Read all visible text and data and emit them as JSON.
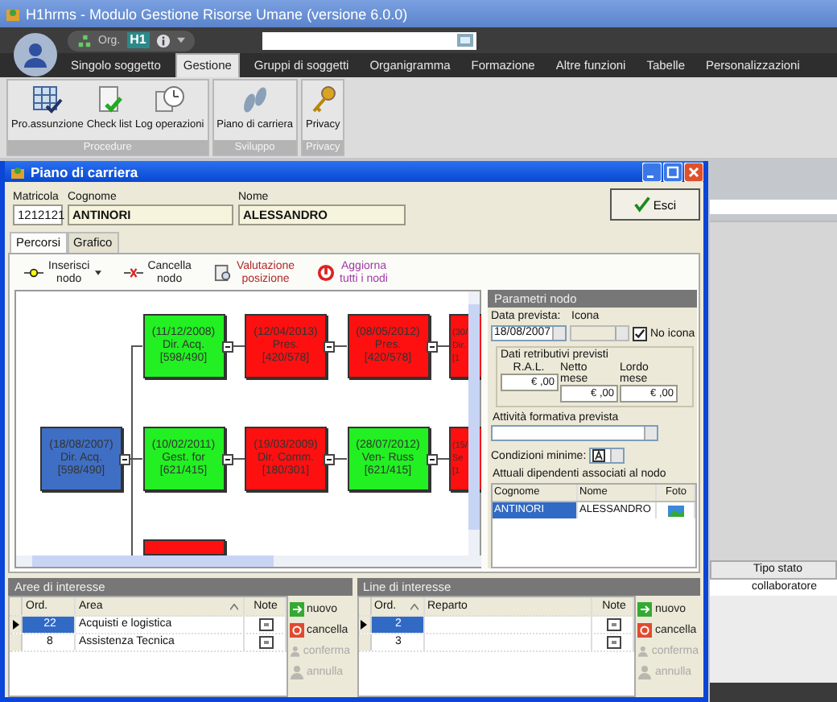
{
  "window": {
    "title": "H1hrms - Modulo Gestione Risorse Umane (versione 6.0.0)"
  },
  "quick_access": {
    "org_label": "Org.",
    "logo": "H1"
  },
  "ribbon_tabs": [
    {
      "label": "Singolo soggetto",
      "selected": false
    },
    {
      "label": "Gestione",
      "selected": true
    },
    {
      "label": "Gruppi di soggetti",
      "selected": false
    },
    {
      "label": "Organigramma",
      "selected": false
    },
    {
      "label": "Formazione",
      "selected": false
    },
    {
      "label": "Altre funzioni",
      "selected": false
    },
    {
      "label": "Tabelle",
      "selected": false
    },
    {
      "label": "Personalizzazioni",
      "selected": false
    }
  ],
  "ribbon_groups": [
    {
      "title": "Procedure",
      "buttons": [
        {
          "label": "Pro.assunzione",
          "kind": "grid"
        },
        {
          "label": "Check list",
          "kind": "checklist"
        },
        {
          "label": "Log operazioni",
          "kind": "clock"
        }
      ]
    },
    {
      "title": "Sviluppo",
      "buttons": [
        {
          "label": "Piano di carriera",
          "kind": "steps"
        }
      ]
    },
    {
      "title": "Privacy",
      "buttons": [
        {
          "label": "Privacy",
          "kind": "key"
        }
      ]
    }
  ],
  "background_table": {
    "column": "Tipo stato",
    "value": "collaboratore"
  },
  "dialog": {
    "title": "Piano di carriera",
    "fields": [
      {
        "label": "Matricola",
        "value": "1212121",
        "readonly": false
      },
      {
        "label": "Cognome",
        "value": "ANTINORI",
        "readonly": true
      },
      {
        "label": "Nome",
        "value": "ALESSANDRO",
        "readonly": true
      }
    ],
    "exit_button": "Esci",
    "tabs": [
      {
        "label": "Percorsi",
        "selected": true
      },
      {
        "label": "Grafico",
        "selected": false
      }
    ],
    "toolbar": [
      {
        "lines": [
          "Inserisci",
          "nodo"
        ],
        "kind": "insert",
        "menu": true,
        "color": "#202020"
      },
      {
        "lines": [
          "Cancella",
          "nodo"
        ],
        "kind": "delete",
        "menu": false,
        "color": "#202020"
      },
      {
        "lines": [
          "Valutazione",
          "posizione"
        ],
        "kind": "evaluate",
        "menu": false,
        "color": "#b02828"
      },
      {
        "lines": [
          "Aggiorna",
          "tutti i nodi"
        ],
        "kind": "refresh",
        "menu": false,
        "color": "#a03ca8"
      }
    ],
    "tree": {
      "lines": [
        "(18/08/2007)",
        "Dir. Acq.",
        "[598/490]"
      ],
      "color": "#3f6fc4",
      "children": [
        {
          "lines": [
            "(11/12/2008)",
            "Dir. Acq.",
            "[598/490]"
          ],
          "color": "#22f022",
          "children": [
            {
              "lines": [
                "(12/04/2013)",
                "Pres.",
                "[420/578]"
              ],
              "color": "#ff1010",
              "children": [
                {
                  "lines": [
                    "(08/05/2012)",
                    "Pres.",
                    "[420/578]"
                  ],
                  "color": "#ff1010",
                  "children": [
                    {
                      "lines": [
                        "(30/",
                        "Dir.",
                        "[1"
                      ],
                      "color": "#ff1010"
                    }
                  ]
                }
              ]
            }
          ]
        },
        {
          "lines": [
            "(10/02/2011)",
            "Gest. for",
            "[621/415]"
          ],
          "color": "#22f022",
          "children": [
            {
              "lines": [
                "(19/03/2009)",
                "Dir. Comm.",
                "[180/301]"
              ],
              "color": "#ff1010",
              "children": [
                {
                  "lines": [
                    "(28/07/2012)",
                    "Ven- Russ",
                    "[621/415]"
                  ],
                  "color": "#22f022",
                  "children": [
                    {
                      "lines": [
                        "(15/",
                        "Se",
                        "[1"
                      ],
                      "color": "#ff1010"
                    }
                  ]
                }
              ]
            }
          ]
        },
        {
          "color": "#ff1010"
        }
      ]
    },
    "node_params": {
      "title": "Parametri nodo",
      "date": {
        "label": "Data prevista:",
        "value": "18/08/2007"
      },
      "icon": {
        "label": "Icona",
        "disabled": true
      },
      "no_icon": {
        "label": "No icona",
        "checked": true
      },
      "salary": {
        "title": "Dati retributivi previsti",
        "fields": [
          {
            "label": "R.A.L.",
            "value": "€ ,00"
          },
          {
            "label": "Netto mese",
            "value": "€ ,00"
          },
          {
            "label": "Lordo mese",
            "value": "€ ,00"
          }
        ]
      },
      "training": {
        "label": "Attività formativa prevista"
      },
      "min_conditions": {
        "label": "Condizioni minime:"
      },
      "employees": {
        "title": "Attuali dipendenti associati al nodo",
        "columns": [
          "Cognome",
          "Nome",
          "Foto"
        ],
        "rows": [
          {
            "cells": [
              "ANTINORI",
              "ALESSANDRO"
            ],
            "selected": true
          }
        ]
      }
    },
    "panels": [
      {
        "title": "Aree di interesse",
        "columns": [
          {
            "label": "Ord.",
            "sorted": false
          },
          {
            "label": "Area",
            "sorted": true
          },
          {
            "label": "Note",
            "sorted": false
          }
        ],
        "rows": [
          {
            "cells": [
              "22",
              "Acquisti e logistica"
            ],
            "selected": true
          },
          {
            "cells": [
              "8",
              "Assistenza Tecnica"
            ],
            "selected": false
          }
        ],
        "buttons": [
          {
            "label": "nuovo",
            "kind": "new",
            "disabled": false
          },
          {
            "label": "cancella",
            "kind": "delete",
            "disabled": false
          },
          {
            "label": "conferma",
            "kind": "confirm",
            "disabled": true
          },
          {
            "label": "annulla",
            "kind": "cancel",
            "disabled": true
          }
        ]
      },
      {
        "title": "Line di interesse",
        "columns": [
          {
            "label": "Ord.",
            "sorted": true
          },
          {
            "label": "Reparto",
            "sorted": false
          },
          {
            "label": "Note",
            "sorted": false
          }
        ],
        "rows": [
          {
            "cells": [
              "2"
            ],
            "selected": true
          },
          {
            "cells": [
              "3"
            ],
            "selected": false
          }
        ],
        "buttons": [
          {
            "label": "nuovo",
            "kind": "new",
            "disabled": false
          },
          {
            "label": "cancella",
            "kind": "delete",
            "disabled": false
          },
          {
            "label": "conferma",
            "kind": "confirm",
            "disabled": true
          },
          {
            "label": "annulla",
            "kind": "cancel",
            "disabled": true
          }
        ]
      }
    ]
  }
}
